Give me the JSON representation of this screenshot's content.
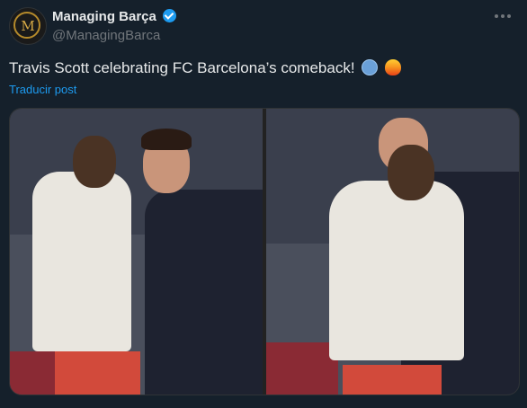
{
  "author": {
    "display_name": "Managing Barça",
    "handle": "@ManagingBarca",
    "avatar_monogram": "M",
    "verified": true,
    "verified_icon": "verified-badge-icon"
  },
  "tweet": {
    "text": "Travis Scott celebrating FC Barcelona’s comeback!",
    "emojis": [
      "stadium-emoji",
      "fire-emoji"
    ],
    "translate_label": "Traducir post"
  },
  "colors": {
    "background": "#15202b",
    "text": "#e7e9ea",
    "secondary_text": "#71767b",
    "accent": "#1d9bf0"
  },
  "media": {
    "count": 2
  }
}
